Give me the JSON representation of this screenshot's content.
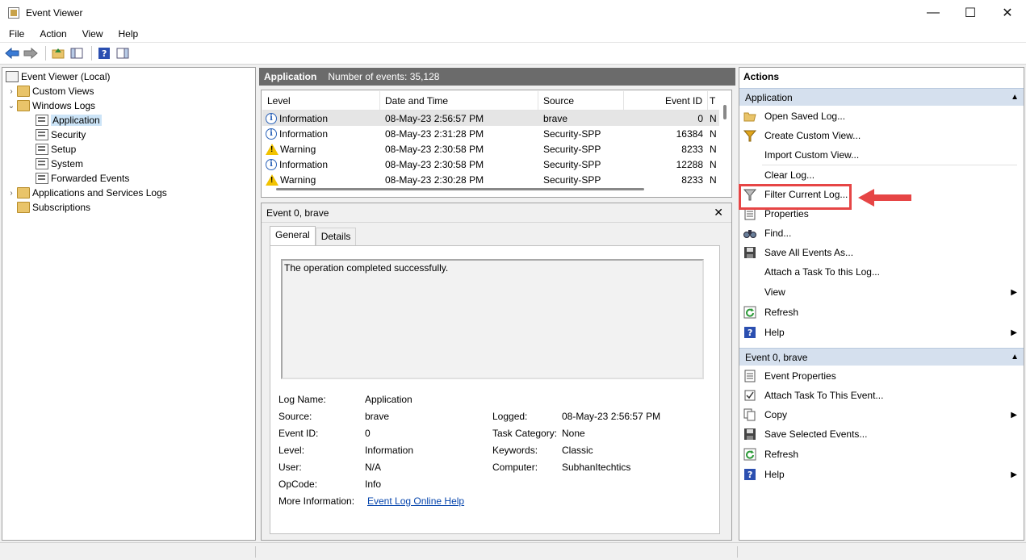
{
  "window": {
    "title": "Event Viewer"
  },
  "menu": [
    "File",
    "Action",
    "View",
    "Help"
  ],
  "tree": {
    "root": "Event Viewer (Local)",
    "custom_views": "Custom Views",
    "windows_logs": "Windows Logs",
    "application": "Application",
    "security": "Security",
    "setup": "Setup",
    "system": "System",
    "forwarded": "Forwarded Events",
    "apps_services": "Applications and Services Logs",
    "subscriptions": "Subscriptions"
  },
  "center": {
    "log_name": "Application",
    "count_text": "Number of events: 35,128",
    "columns": [
      "Level",
      "Date and Time",
      "Source",
      "Event ID",
      "T"
    ],
    "rows": [
      {
        "level": "Information",
        "icon": "info-icon",
        "date": "08-May-23 2:56:57 PM",
        "source": "brave",
        "id": "0",
        "t": "N"
      },
      {
        "level": "Information",
        "icon": "info-icon",
        "date": "08-May-23 2:31:28 PM",
        "source": "Security-SPP",
        "id": "16384",
        "t": "N"
      },
      {
        "level": "Warning",
        "icon": "warning-icon",
        "date": "08-May-23 2:30:58 PM",
        "source": "Security-SPP",
        "id": "8233",
        "t": "N"
      },
      {
        "level": "Information",
        "icon": "info-icon",
        "date": "08-May-23 2:30:58 PM",
        "source": "Security-SPP",
        "id": "12288",
        "t": "N"
      },
      {
        "level": "Warning",
        "icon": "warning-icon",
        "date": "08-May-23 2:30:28 PM",
        "source": "Security-SPP",
        "id": "8233",
        "t": "N"
      }
    ]
  },
  "details": {
    "header": "Event 0, brave",
    "tabs": [
      "General",
      "Details"
    ],
    "description": "The operation completed successfully.",
    "labels": {
      "log_name": "Log Name:",
      "source": "Source:",
      "event_id": "Event ID:",
      "level": "Level:",
      "user": "User:",
      "opcode": "OpCode:",
      "more_info": "More Information:",
      "logged": "Logged:",
      "task_category": "Task Category:",
      "keywords": "Keywords:",
      "computer": "Computer:"
    },
    "values": {
      "log_name": "Application",
      "source": "brave",
      "event_id": "0",
      "level": "Information",
      "user": "N/A",
      "opcode": "Info",
      "more_info": "Event Log Online Help",
      "logged": "08-May-23 2:56:57 PM",
      "task_category": "None",
      "keywords": "Classic",
      "computer": "SubhanItechtics"
    }
  },
  "actions": {
    "title": "Actions",
    "section1": "Application",
    "section1_items": [
      "Open Saved Log...",
      "Create Custom View...",
      "Import Custom View...",
      "Clear Log...",
      "Filter Current Log...",
      "Properties",
      "Find...",
      "Save All Events As...",
      "Attach a Task To this Log...",
      "View",
      "Refresh",
      "Help"
    ],
    "section2": "Event 0, brave",
    "section2_items": [
      "Event Properties",
      "Attach Task To This Event...",
      "Copy",
      "Save Selected Events...",
      "Refresh",
      "Help"
    ]
  },
  "colors": {
    "highlight": "#e64545",
    "section_bg": "#d5e0ee",
    "header_bg": "#6b6b6b"
  }
}
